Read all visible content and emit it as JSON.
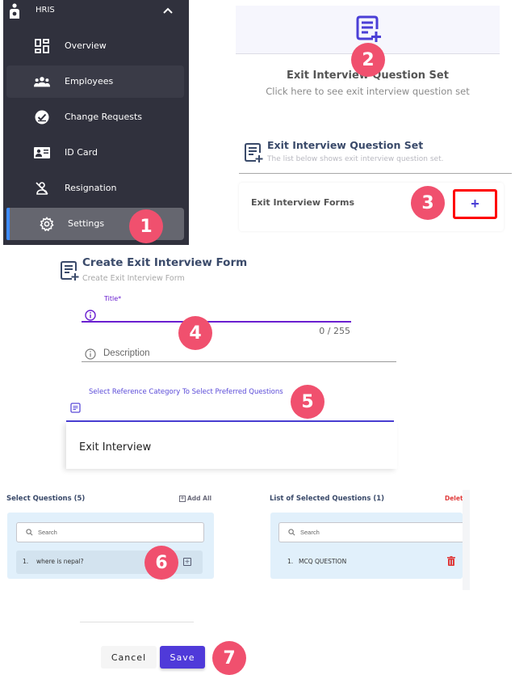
{
  "sidebar": {
    "group_label": "HRIS",
    "items": [
      {
        "label": "Overview",
        "icon": "dashboard-icon"
      },
      {
        "label": "Employees",
        "icon": "people-icon"
      },
      {
        "label": "Change Requests",
        "icon": "check-circle-icon"
      },
      {
        "label": "ID Card",
        "icon": "id-card-icon"
      },
      {
        "label": "Resignation",
        "icon": "person-off-icon"
      },
      {
        "label": "Settings",
        "icon": "gear-icon"
      }
    ]
  },
  "steps": [
    "1",
    "2",
    "3",
    "4",
    "5",
    "6",
    "7"
  ],
  "question_set_card": {
    "title": "Exit Interview Question Set",
    "subtitle": "Click here to see exit interview question set"
  },
  "question_set_page": {
    "title": "Exit Interview Question Set",
    "subtitle": "The list below shows exit interview question set.",
    "section_label": "Exit Interview Forms",
    "add_label": "+"
  },
  "create_form": {
    "title": "Create Exit Interview Form",
    "subtitle": "Create Exit Interview Form",
    "title_field_label": "Title*",
    "title_value": "",
    "char_count": "0 / 255",
    "description_placeholder": "Description",
    "description_value": "",
    "reference_label": "Select Reference Category To Select Preferred Questions",
    "reference_option": "Exit Interview"
  },
  "select_questions": {
    "title": "Select Questions (5)",
    "add_all_label": "Add All",
    "search_placeholder": "Search",
    "items": [
      {
        "num": "1.",
        "text": "where is nepal?"
      }
    ]
  },
  "selected_questions": {
    "title": "List of Selected Questions (1)",
    "delete_all_label": "Delete All",
    "search_placeholder": "Search",
    "items": [
      {
        "num": "1.",
        "text": "MCQ QUESTION"
      }
    ]
  },
  "actions": {
    "cancel_label": "Cancel",
    "save_label": "Save"
  },
  "colors": {
    "sidebar_bg": "#30313d",
    "accent": "#4f3ad9",
    "badge": "#f0506e",
    "highlight_border": "#ff0000",
    "danger": "#e03a3a"
  }
}
